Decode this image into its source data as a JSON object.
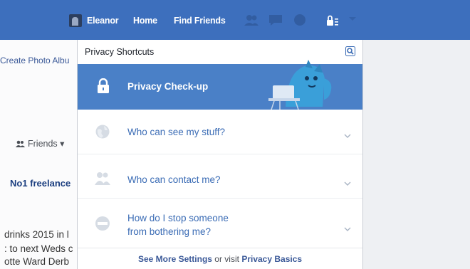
{
  "nav": {
    "user_name": "Eleanor",
    "home_label": "Home",
    "find_friends_label": "Find Friends",
    "icons": [
      "friend-requests-icon",
      "messages-icon",
      "notifications-icon",
      "privacy-shortcuts-icon"
    ]
  },
  "background": {
    "create_album": "Create Photo Albu",
    "friends_button": "Friends",
    "freelance_text": "No1 freelance",
    "post_lines": [
      "drinks 2015 in l",
      ": to next Weds c",
      "otte Ward Derb"
    ]
  },
  "privacy_menu": {
    "title": "Privacy Shortcuts",
    "checkup_label": "Privacy Check-up",
    "items": [
      {
        "label_line1": "Who can see my stuff?",
        "label_line2": "",
        "icon": "globe-icon"
      },
      {
        "label_line1": "Who can contact me?",
        "label_line2": "",
        "icon": "people-icon"
      },
      {
        "label_line1": "How do I stop someone",
        "label_line2": "from bothering me?",
        "icon": "block-icon"
      }
    ],
    "footer_link": "See More Settings",
    "footer_text": " or visit ",
    "footer_link2": "Privacy Basics"
  },
  "colors": {
    "topbar": "#3d6fbd",
    "checkup_bg": "#4a80c7",
    "link": "#3b6cb5"
  }
}
